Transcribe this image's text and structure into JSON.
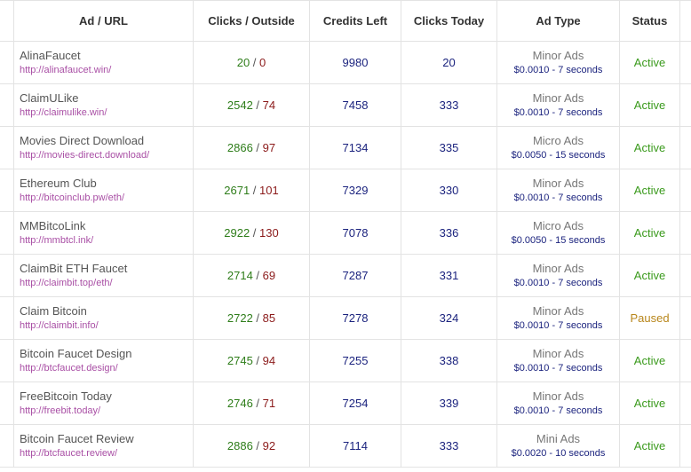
{
  "table": {
    "headers": {
      "ad": "Ad / URL",
      "clicks": "Clicks / Outside",
      "credits": "Credits Left",
      "today": "Clicks Today",
      "type": "Ad Type",
      "status": "Status"
    },
    "rows": [
      {
        "name": "AlinaFaucet",
        "url": "http://alinafaucet.win/",
        "clicks": "20",
        "outside": "0",
        "credits": "9980",
        "today": "20",
        "type": "Minor Ads",
        "rate": "$0.0010 - 7 seconds",
        "status": "Active"
      },
      {
        "name": "ClaimULike",
        "url": "http://claimulike.win/",
        "clicks": "2542",
        "outside": "74",
        "credits": "7458",
        "today": "333",
        "type": "Minor Ads",
        "rate": "$0.0010 - 7 seconds",
        "status": "Active"
      },
      {
        "name": "Movies Direct Download",
        "url": "http://movies-direct.download/",
        "clicks": "2866",
        "outside": "97",
        "credits": "7134",
        "today": "335",
        "type": "Micro Ads",
        "rate": "$0.0050 - 15 seconds",
        "status": "Active"
      },
      {
        "name": "Ethereum Club",
        "url": "http://bitcoinclub.pw/eth/",
        "clicks": "2671",
        "outside": "101",
        "credits": "7329",
        "today": "330",
        "type": "Minor Ads",
        "rate": "$0.0010 - 7 seconds",
        "status": "Active"
      },
      {
        "name": "MMBitcoLink",
        "url": "http://mmbtcl.ink/",
        "clicks": "2922",
        "outside": "130",
        "credits": "7078",
        "today": "336",
        "type": "Micro Ads",
        "rate": "$0.0050 - 15 seconds",
        "status": "Active"
      },
      {
        "name": "ClaimBit ETH Faucet",
        "url": "http://claimbit.top/eth/",
        "clicks": "2714",
        "outside": "69",
        "credits": "7287",
        "today": "331",
        "type": "Minor Ads",
        "rate": "$0.0010 - 7 seconds",
        "status": "Active"
      },
      {
        "name": "Claim Bitcoin",
        "url": "http://claimbit.info/",
        "clicks": "2722",
        "outside": "85",
        "credits": "7278",
        "today": "324",
        "type": "Minor Ads",
        "rate": "$0.0010 - 7 seconds",
        "status": "Paused"
      },
      {
        "name": "Bitcoin Faucet Design",
        "url": "http://btcfaucet.design/",
        "clicks": "2745",
        "outside": "94",
        "credits": "7255",
        "today": "338",
        "type": "Minor Ads",
        "rate": "$0.0010 - 7 seconds",
        "status": "Active"
      },
      {
        "name": "FreeBitcoin Today",
        "url": "http://freebit.today/",
        "clicks": "2746",
        "outside": "71",
        "credits": "7254",
        "today": "339",
        "type": "Minor Ads",
        "rate": "$0.0010 - 7 seconds",
        "status": "Active"
      },
      {
        "name": "Bitcoin Faucet Review",
        "url": "http://btcfaucet.review/",
        "clicks": "2886",
        "outside": "92",
        "credits": "7114",
        "today": "333",
        "type": "Mini Ads",
        "rate": "$0.0020 - 10 seconds",
        "status": "Active"
      }
    ]
  },
  "colors": {
    "clicks_in": "#2e7d1a",
    "clicks_out": "#8b1a1a",
    "numbers": "#1b237e",
    "url": "#a94fa5",
    "status_active": "#3a9a1c",
    "status_paused": "#b8861b"
  }
}
